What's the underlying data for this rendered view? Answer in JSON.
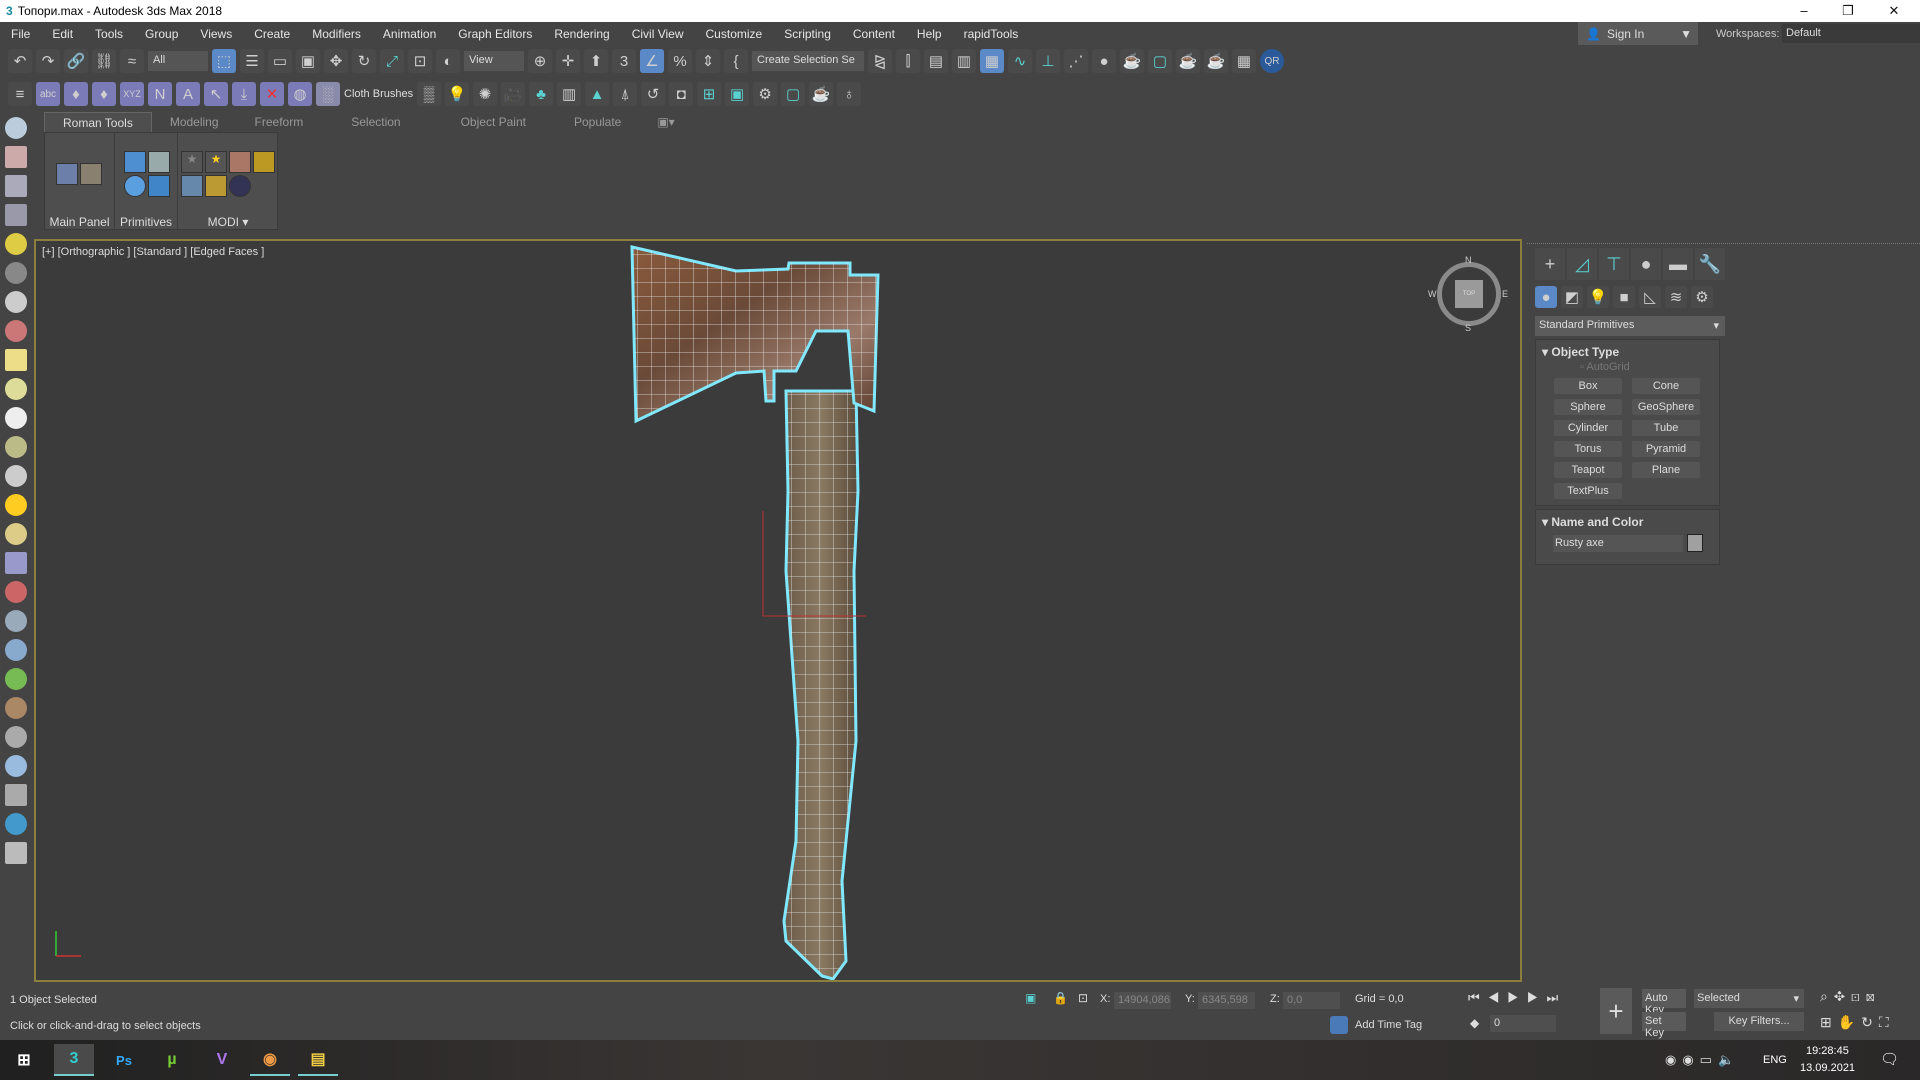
{
  "window": {
    "title": "Топори.max - Autodesk 3ds Max 2018",
    "minimize": "–",
    "restore": "❐",
    "close": "✕"
  },
  "menu": [
    "File",
    "Edit",
    "Tools",
    "Group",
    "Views",
    "Create",
    "Modifiers",
    "Animation",
    "Graph Editors",
    "Rendering",
    "Civil View",
    "Customize",
    "Scripting",
    "Content",
    "Help",
    "rapidTools"
  ],
  "account": {
    "sign_in": "Sign In",
    "workspaces_label": "Workspaces:",
    "workspace": "Default"
  },
  "toolbar": {
    "filter": "All",
    "ref_coord": "View",
    "selection_set": "Create Selection Se",
    "cloth_brushes": "Cloth Brushes"
  },
  "ribbon": {
    "tabs": [
      "Roman Tools",
      "Modeling",
      "Freeform",
      "Selection",
      "Object Paint",
      "Populate"
    ],
    "groups": [
      "Main Panel",
      "Primitives",
      "MODI"
    ]
  },
  "viewport": {
    "label": "[+] [Orthographic ] [Standard ] [Edged Faces ]",
    "viewcube": {
      "top": "TOP",
      "n": "N",
      "s": "S",
      "e": "E",
      "w": "W"
    }
  },
  "command_panel": {
    "category": "Standard Primitives",
    "rollout_object_type": "Object Type",
    "autogrid": "AutoGrid",
    "buttons": [
      "Box",
      "Cone",
      "Sphere",
      "GeoSphere",
      "Cylinder",
      "Tube",
      "Torus",
      "Pyramid",
      "Teapot",
      "Plane",
      "TextPlus"
    ],
    "rollout_name_color": "Name and Color",
    "object_name": "Rusty axe",
    "object_color": "#a0a0a0"
  },
  "status": {
    "selected": "1 Object Selected",
    "prompt": "Click or click-and-drag to select objects",
    "x_label": "X:",
    "x": "14904,086",
    "y_label": "Y:",
    "y": "6345,598",
    "z_label": "Z:",
    "z": "0,0",
    "grid": "Grid = 0,0",
    "add_time_tag": "Add Time Tag",
    "frame": "0",
    "auto_key": "Auto Key",
    "set_key": "Set Key",
    "key_mode": "Selected",
    "key_filters": "Key Filters..."
  },
  "taskbar": {
    "apps": [
      "3",
      "Ps",
      "µ",
      "V",
      "◉",
      "▤"
    ],
    "lang": "ENG",
    "time": "19:28:45",
    "date": "13.09.2021"
  },
  "colors": {
    "accent": "#5b88c6",
    "viewport_border": "#8c7e3c",
    "selection": "#7fe8ff"
  }
}
